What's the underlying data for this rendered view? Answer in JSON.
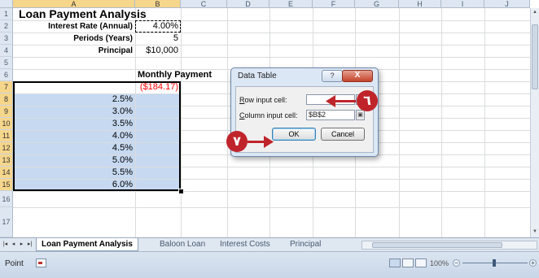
{
  "columns": [
    "A",
    "B",
    "C",
    "D",
    "E",
    "F",
    "G",
    "H",
    "I",
    "J"
  ],
  "rows": [
    "1",
    "2",
    "3",
    "4",
    "5",
    "6",
    "7",
    "8",
    "9",
    "10",
    "11",
    "12",
    "13",
    "14",
    "15",
    "16",
    "17"
  ],
  "sheet": {
    "title": "Loan Payment Analysis",
    "interest_label": "Interest Rate (Annual)",
    "interest_value": "4.00%",
    "periods_label": "Periods (Years)",
    "periods_value": "5",
    "principal_label": "Principal",
    "principal_value": "$10,000",
    "monthly_payment_header": "Monthly Payment",
    "formula_result": "($184.17)",
    "rates": [
      "2.5%",
      "3.0%",
      "3.5%",
      "4.0%",
      "4.5%",
      "5.0%",
      "5.5%",
      "6.0%"
    ]
  },
  "dialog": {
    "title": "Data Table",
    "help": "?",
    "close": "X",
    "row_label_key": "R",
    "row_label_rest": "ow input cell:",
    "row_value": "",
    "col_label_key": "C",
    "col_label_rest": "olumn input cell:",
    "col_value": "$B$2",
    "ok": "OK",
    "cancel": "Cancel"
  },
  "callouts": {
    "step6": "٦",
    "step7": "٧",
    "color": "#c0242b"
  },
  "tabs": [
    "Loan Payment Analysis",
    "Baloon Loan",
    "Interest Costs",
    "Principal"
  ],
  "active_tab": "Loan Payment Analysis",
  "status": {
    "mode": "Point",
    "zoom": "100%"
  },
  "colors": {
    "selection": "#c6d9f1",
    "header": "#dde6f1",
    "negative": "#ff0000"
  }
}
